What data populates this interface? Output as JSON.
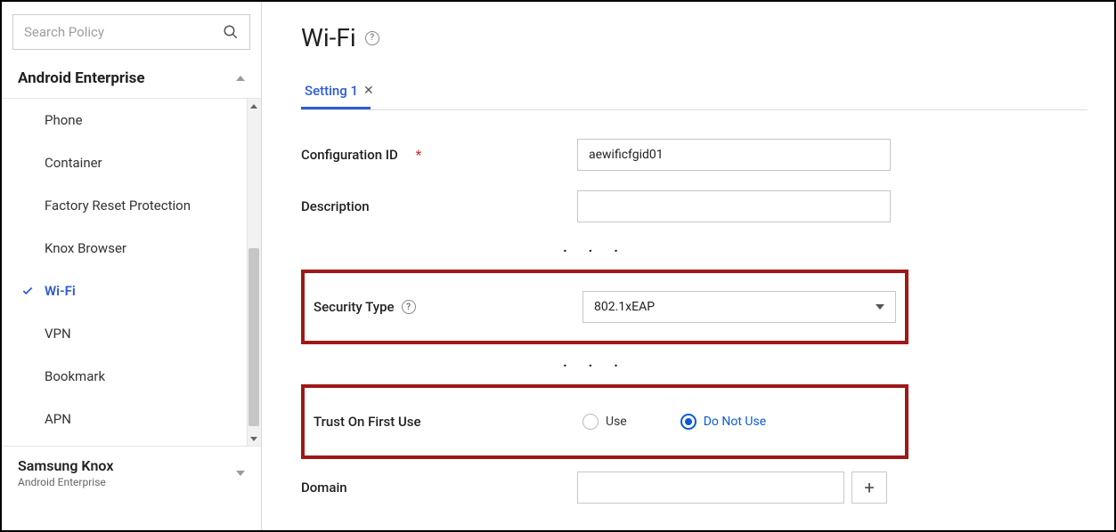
{
  "search": {
    "placeholder": "Search Policy"
  },
  "accordion": {
    "title": "Android Enterprise"
  },
  "nav_items": [
    {
      "label": "Phone",
      "active": false
    },
    {
      "label": "Container",
      "active": false
    },
    {
      "label": "Factory Reset Protection",
      "active": false
    },
    {
      "label": "Knox Browser",
      "active": false
    },
    {
      "label": "Wi-Fi",
      "active": true
    },
    {
      "label": "VPN",
      "active": false
    },
    {
      "label": "Bookmark",
      "active": false
    },
    {
      "label": "APN",
      "active": false
    }
  ],
  "bottom": {
    "title": "Samsung Knox",
    "subtitle": "Android Enterprise"
  },
  "page": {
    "title": "Wi-Fi"
  },
  "tab": {
    "label": "Setting 1"
  },
  "ellipsis": ". . .",
  "fields": {
    "config_id": {
      "label": "Configuration ID",
      "value": "aewificfgid01"
    },
    "description": {
      "label": "Description",
      "value": ""
    },
    "security_type": {
      "label": "Security Type",
      "value": "802.1xEAP"
    },
    "tofu": {
      "label": "Trust On First Use",
      "options": {
        "use": "Use",
        "donotuse": "Do Not Use"
      }
    },
    "domain": {
      "label": "Domain",
      "value": ""
    }
  }
}
